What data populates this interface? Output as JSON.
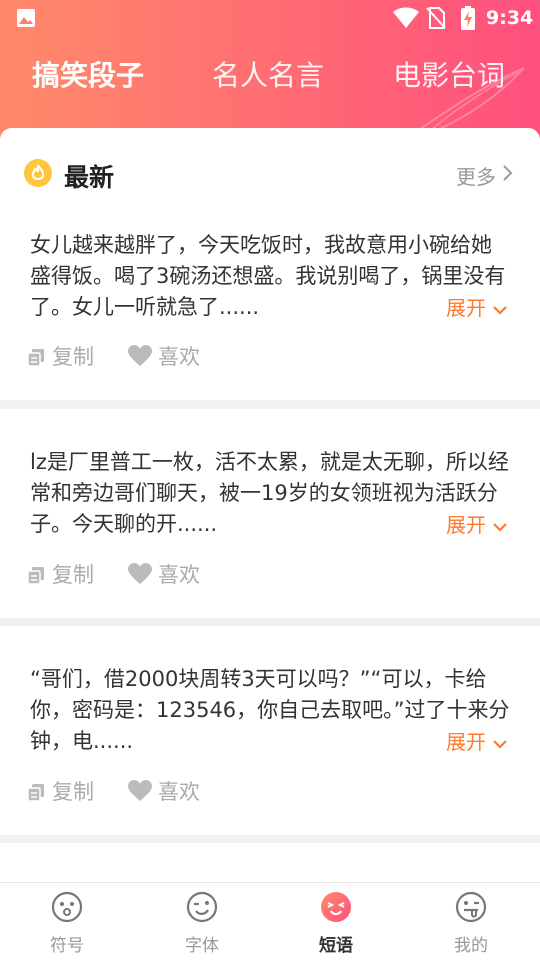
{
  "status_bar": {
    "time": "9:34"
  },
  "tabs": [
    {
      "label": "搞笑段子",
      "active": true
    },
    {
      "label": "名人名言",
      "active": false
    },
    {
      "label": "电影台词",
      "active": false
    }
  ],
  "section": {
    "title": "最新",
    "more_label": "更多"
  },
  "cards": [
    {
      "text": "女儿越来越胖了，今天吃饭时，我故意用小碗给她盛得饭。喝了3碗汤还想盛。我说别喝了，锅里没有了。女儿一听就急了......",
      "expand_label": "展开",
      "copy_label": "复制",
      "like_label": "喜欢"
    },
    {
      "text": "lz是厂里普工一枚，活不太累，就是太无聊，所以经常和旁边哥们聊天，被一19岁的女领班视为活跃分子。今天聊的开......",
      "expand_label": "展开",
      "copy_label": "复制",
      "like_label": "喜欢"
    },
    {
      "text": "“哥们，借2000块周转3天可以吗？”“可以，卡给你，密码是：123546，你自己去取吧。”过了十来分钟，电......",
      "expand_label": "展开",
      "copy_label": "复制",
      "like_label": "喜欢"
    }
  ],
  "bottom_nav": [
    {
      "label": "符号",
      "icon": "smiley-icon",
      "active": false
    },
    {
      "label": "字体",
      "icon": "wink-icon",
      "active": false
    },
    {
      "label": "短语",
      "icon": "happy-icon",
      "active": true
    },
    {
      "label": "我的",
      "icon": "tongue-icon",
      "active": false
    }
  ],
  "colors": {
    "header_gradient_start": "#ff8a6a",
    "header_gradient_end": "#ff4f7e",
    "expand_orange": "#ff7a2a",
    "fire_yellow": "#ffc53d",
    "active_nav_pink": "#ff4f7e"
  }
}
